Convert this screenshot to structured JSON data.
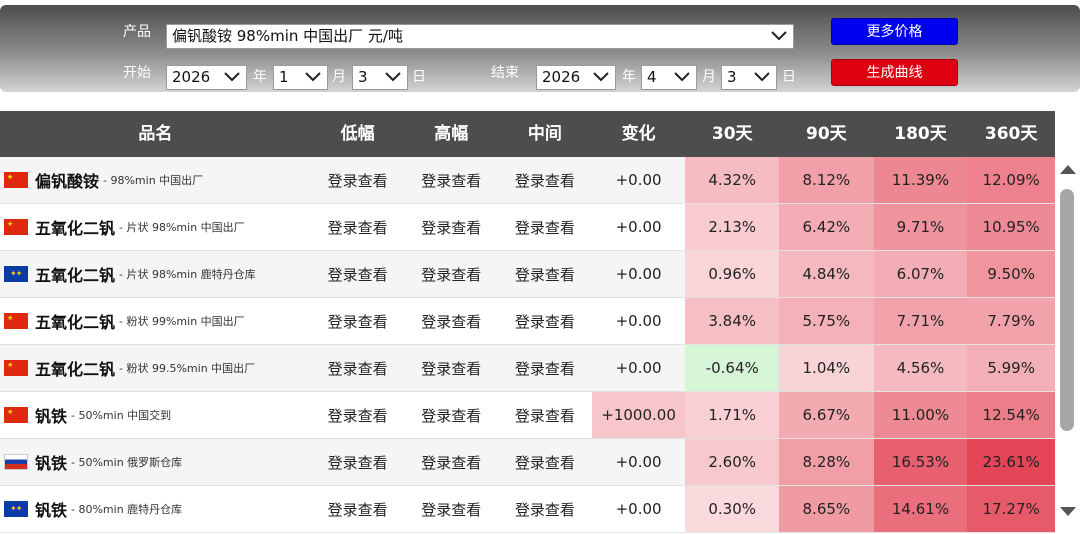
{
  "filter": {
    "product_label": "产品",
    "product_value": "偏钒酸铵 98%min 中国出厂 元/吨",
    "start_label": "开始",
    "end_label": "结束",
    "year_unit": "年",
    "month_unit": "月",
    "day_unit": "日",
    "start": {
      "year": "2026",
      "month": "1",
      "day": "3"
    },
    "end": {
      "year": "2026",
      "month": "4",
      "day": "3"
    },
    "more_prices_button": "更多价格",
    "generate_chart_button": "生成曲线"
  },
  "table": {
    "columns": [
      "品名",
      "低幅",
      "高幅",
      "中间",
      "变化",
      "30天",
      "90天",
      "180天",
      "360天"
    ],
    "rows": [
      {
        "flag": "china-flag",
        "name": "偏钒酸铵",
        "desc": "98%min 中国出厂",
        "low": "登录查看",
        "high": "登录查看",
        "mid": "登录查看",
        "change": "+0.00",
        "d30": "4.32%",
        "d90": "8.12%",
        "d180": "11.39%",
        "d360": "12.09%"
      },
      {
        "flag": "china-flag",
        "name": "五氧化二钒",
        "desc": "片状 98%min 中国出厂",
        "low": "登录查看",
        "high": "登录查看",
        "mid": "登录查看",
        "change": "+0.00",
        "d30": "2.13%",
        "d90": "6.42%",
        "d180": "9.71%",
        "d360": "10.95%"
      },
      {
        "flag": "eu-flag",
        "name": "五氧化二钒",
        "desc": "片状 98%min 鹿特丹仓库",
        "low": "登录查看",
        "high": "登录查看",
        "mid": "登录查看",
        "change": "+0.00",
        "d30": "0.96%",
        "d90": "4.84%",
        "d180": "6.07%",
        "d360": "9.50%"
      },
      {
        "flag": "china-flag",
        "name": "五氧化二钒",
        "desc": "粉状 99%min 中国出厂",
        "low": "登录查看",
        "high": "登录查看",
        "mid": "登录查看",
        "change": "+0.00",
        "d30": "3.84%",
        "d90": "5.75%",
        "d180": "7.71%",
        "d360": "7.79%"
      },
      {
        "flag": "china-flag",
        "name": "五氧化二钒",
        "desc": "粉状 99.5%min 中国出厂",
        "low": "登录查看",
        "high": "登录查看",
        "mid": "登录查看",
        "change": "+0.00",
        "d30": "-0.64%",
        "d90": "1.04%",
        "d180": "4.56%",
        "d360": "5.99%"
      },
      {
        "flag": "china-flag",
        "name": "钒铁",
        "desc": "50%min 中国交到",
        "low": "登录查看",
        "high": "登录查看",
        "mid": "登录查看",
        "change": "+1000.00",
        "d30": "1.71%",
        "d90": "6.67%",
        "d180": "11.00%",
        "d360": "12.54%"
      },
      {
        "flag": "russia-flag",
        "name": "钒铁",
        "desc": "50%min 俄罗斯仓库",
        "low": "登录查看",
        "high": "登录查看",
        "mid": "登录查看",
        "change": "+0.00",
        "d30": "2.60%",
        "d90": "8.28%",
        "d180": "16.53%",
        "d360": "23.61%"
      },
      {
        "flag": "eu-flag",
        "name": "钒铁",
        "desc": "80%min 鹿特丹仓库",
        "low": "登录查看",
        "high": "登录查看",
        "mid": "登录查看",
        "change": "+0.00",
        "d30": "0.30%",
        "d90": "8.65%",
        "d180": "14.61%",
        "d360": "17.27%"
      }
    ]
  }
}
